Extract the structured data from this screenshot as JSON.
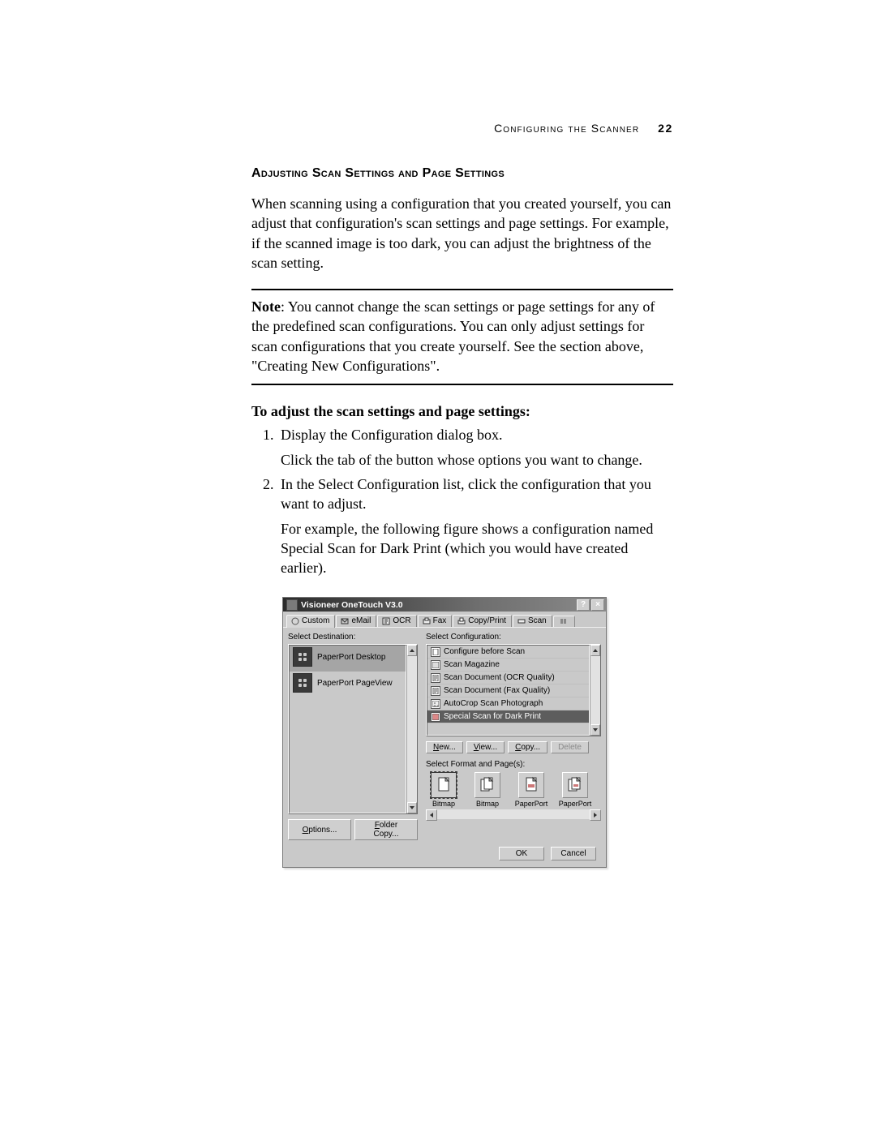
{
  "header": {
    "running_text": "Configuring the Scanner",
    "page_number": "22"
  },
  "section": {
    "heading": "Adjusting Scan Settings and Page Settings",
    "intro": "When scanning using a configuration that you created yourself, you can adjust that configuration's scan settings and page settings. For example, if the scanned image is too dark, you can adjust the brightness of the scan setting.",
    "note_label": "Note",
    "note_text": ":  You cannot change the scan settings or page settings for any of the predefined scan configurations. You can only adjust settings for scan configurations that you create yourself. See the section above, \"Creating New Configurations\".",
    "subhead": "To adjust the scan settings and page settings:",
    "steps": {
      "s1a": "Display the Configuration dialog box.",
      "s1b": "Click the tab of the button whose options you want to change.",
      "s2a": "In the Select Configuration list, click the configuration that you want to adjust.",
      "s2b": "For example, the following figure shows a configuration named Special Scan for Dark Print (which you would have created earlier)."
    }
  },
  "dialog": {
    "title": "Visioneer OneTouch V3.0",
    "help_btn": "?",
    "close_btn": "×",
    "tabs": [
      "Custom",
      "eMail",
      "OCR",
      "Fax",
      "Copy/Print",
      "Scan"
    ],
    "labels": {
      "select_destination": "Select Destination:",
      "select_configuration": "Select Configuration:",
      "select_format": "Select Format and Page(s):"
    },
    "destinations": [
      {
        "name": "PaperPort Desktop",
        "selected": true
      },
      {
        "name": "PaperPort PageView",
        "selected": false
      }
    ],
    "configurations": [
      {
        "name": "Configure before Scan",
        "selected": false
      },
      {
        "name": "Scan Magazine",
        "selected": false
      },
      {
        "name": "Scan Document (OCR Quality)",
        "selected": false
      },
      {
        "name": "Scan Document (Fax Quality)",
        "selected": false
      },
      {
        "name": "AutoCrop Scan Photograph",
        "selected": false
      },
      {
        "name": "Special Scan for Dark Print",
        "selected": true
      }
    ],
    "config_buttons": {
      "new": "New...",
      "view": "View...",
      "copy": "Copy...",
      "delete": "Delete"
    },
    "formats": [
      {
        "label": "Bitmap",
        "selected": true,
        "multi": false
      },
      {
        "label": "Bitmap",
        "selected": false,
        "multi": true
      },
      {
        "label": "PaperPort",
        "selected": false,
        "multi": false
      },
      {
        "label": "PaperPort",
        "selected": false,
        "multi": true
      }
    ],
    "left_buttons": {
      "options": "Options...",
      "folder_copy": "Folder Copy..."
    },
    "footer": {
      "ok": "OK",
      "cancel": "Cancel"
    }
  }
}
